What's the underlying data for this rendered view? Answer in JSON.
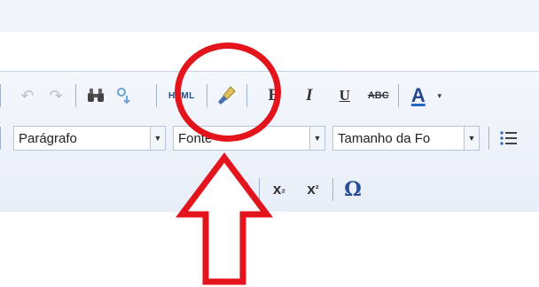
{
  "toolbar_row1": {
    "undo_icon": "undo-icon",
    "redo_icon": "redo-icon",
    "find_icon": "binoculars-icon",
    "replace_icon": "replace-icon",
    "html_label": "HTML",
    "cleanup_icon": "broom-icon",
    "bold_label": "B",
    "italic_label": "I",
    "underline_label": "U",
    "strike_label": "ABC",
    "fontcolor_label": "A"
  },
  "toolbar_row2": {
    "paragraph_value": "Parágrafo",
    "font_value": "Fonte",
    "fontsize_value": "Tamanho da Fo"
  },
  "toolbar_row3": {
    "subscript_label": "x",
    "subscript_mark": "₂",
    "superscript_label": "x",
    "superscript_mark": "²",
    "special_char_label": "Ω"
  },
  "colors": {
    "annotation_red": "#e4141c",
    "accent_blue": "#1f66c5"
  }
}
